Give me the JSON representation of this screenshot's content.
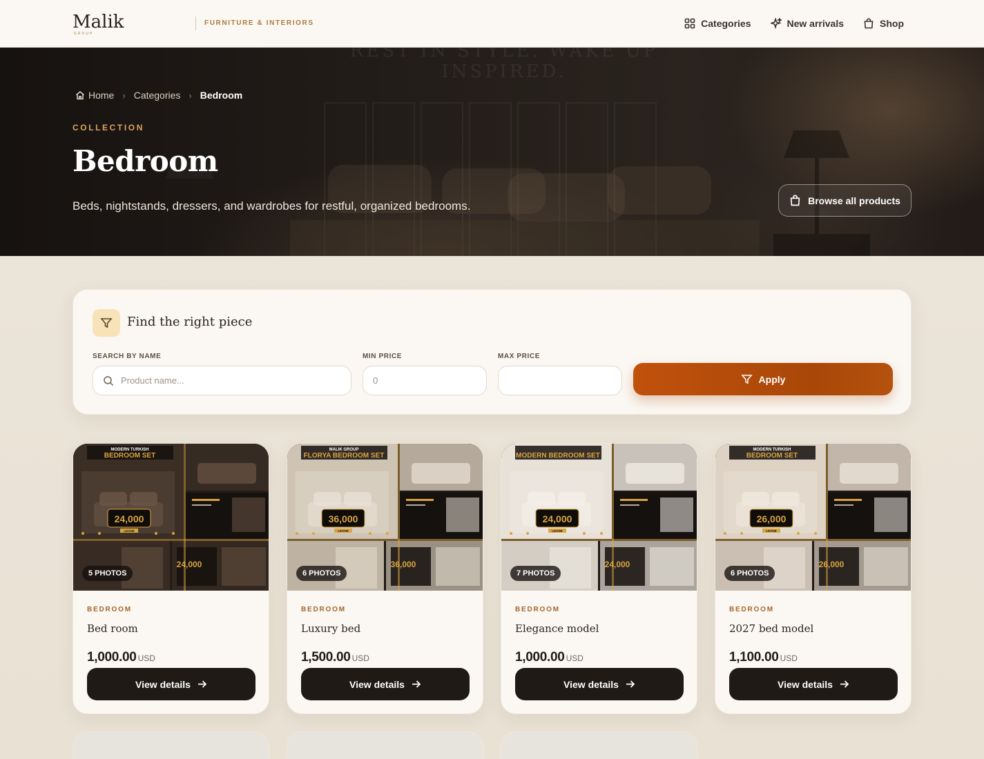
{
  "brand": {
    "name": "Malik",
    "sub": "GROUP",
    "tagline": "FURNITURE & INTERIORS"
  },
  "nav": [
    {
      "label": "Categories",
      "icon": "grid-icon"
    },
    {
      "label": "New arrivals",
      "icon": "sparkles-icon"
    },
    {
      "label": "Shop",
      "icon": "bag-icon"
    }
  ],
  "hero": {
    "ghost_text": "REST IN STYLE. WAKE UP INSPIRED.",
    "breadcrumb": [
      {
        "label": "Home",
        "icon": "home-icon"
      },
      {
        "label": "Categories"
      },
      {
        "label": "Bedroom"
      }
    ],
    "eyebrow": "COLLECTION",
    "title": "Bedroom",
    "description": "Beds, nightstands, dressers, and wardrobes for restful, organized bedrooms.",
    "browse_label": "Browse all products"
  },
  "filter": {
    "title": "Find the right piece",
    "search_label": "SEARCH BY NAME",
    "search_placeholder": "Product name...",
    "search_value": "",
    "min_label": "MIN PRICE",
    "min_placeholder": "0",
    "min_value": "",
    "max_label": "MAX PRICE",
    "max_placeholder": "",
    "max_value": "",
    "apply_label": "Apply"
  },
  "products": [
    {
      "category": "BEDROOM",
      "name": "Bed room",
      "price": "1,000.00",
      "currency": "USD",
      "photos": "5 PHOTOS",
      "button": "View details",
      "promo": {
        "headline": "BEDROOM SET",
        "overline": "MODERN TURKISH",
        "price_a": "24,000",
        "price_b": "24,000",
        "currency": "LEONE"
      }
    },
    {
      "category": "BEDROOM",
      "name": "Luxury bed",
      "price": "1,500.00",
      "currency": "USD",
      "photos": "6 PHOTOS",
      "button": "View details",
      "promo": {
        "headline": "FLORYA BEDROOM SET",
        "overline": "MALIK GROUP",
        "price_a": "36,000",
        "price_b": "36,000",
        "currency": "LEONE"
      }
    },
    {
      "category": "BEDROOM",
      "name": "Elegance model",
      "price": "1,000.00",
      "currency": "USD",
      "photos": "7 PHOTOS",
      "button": "View details",
      "promo": {
        "headline": "MODERN BEDROOM SET",
        "overline": "",
        "price_a": "24,000",
        "price_b": "24,000",
        "currency": "LEONE"
      }
    },
    {
      "category": "BEDROOM",
      "name": "2027 bed model",
      "price": "1,100.00",
      "currency": "USD",
      "photos": "6 PHOTOS",
      "button": "View details",
      "promo": {
        "headline": "BEDROOM SET",
        "overline": "MODERN TURKISH",
        "price_a": "26,000",
        "price_b": "26,000",
        "currency": "LEONE"
      }
    }
  ],
  "colors": {
    "accent": "#b9500c",
    "dark": "#201a16",
    "gold": "#d9a55c",
    "cream": "#fbf8f3"
  }
}
